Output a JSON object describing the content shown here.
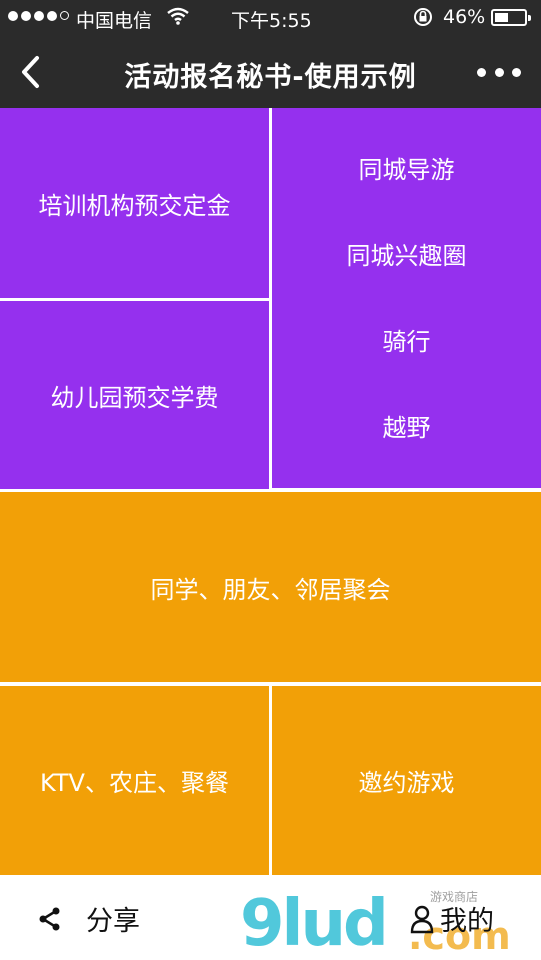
{
  "status_bar": {
    "carrier": "中国电信",
    "time": "下午5:55",
    "battery": "46%",
    "battery_level": 0.46
  },
  "nav": {
    "title": "活动报名秘书-使用示例"
  },
  "tiles": {
    "training_deposit": "培训机构预交定金",
    "kindergarten_fee": "幼儿园预交学费",
    "local_guide": "同城导游",
    "local_interest": "同城兴趣圈",
    "cycling": "骑行",
    "offroad": "越野",
    "gathering": "同学、朋友、邻居聚会",
    "ktv": "KTV、农庄、聚餐",
    "games": "邀约游戏"
  },
  "bottom_bar": {
    "share_label": "分享",
    "mine_label": "我的"
  },
  "watermark": {
    "text": "9lud.com",
    "small_text": "游戏商店"
  },
  "colors": {
    "bar": "#2b2b2b",
    "purple": "#9530ee",
    "orange": "#f2a007"
  },
  "icons": [
    "back-icon",
    "more-icon",
    "share-icon",
    "user-icon",
    "wifi-icon",
    "lock-rotation-icon",
    "battery-icon"
  ]
}
